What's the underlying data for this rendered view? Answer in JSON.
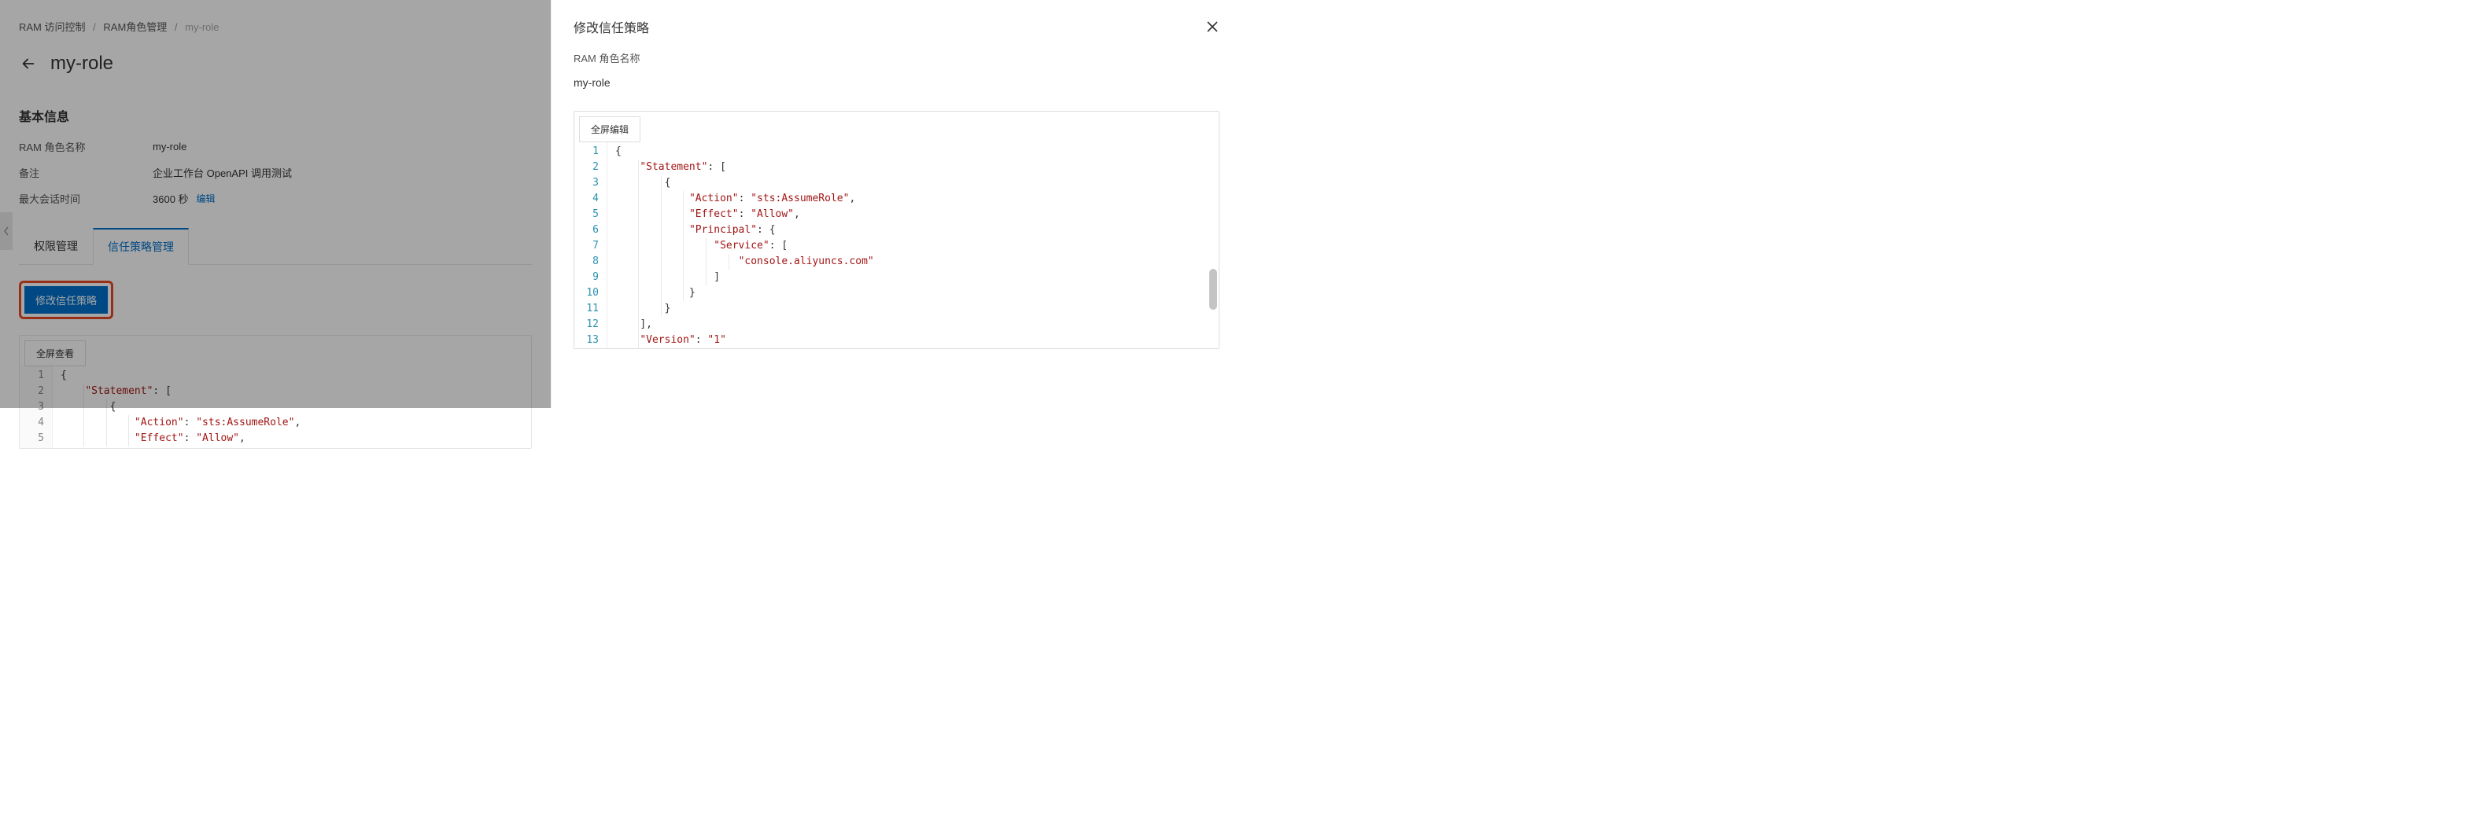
{
  "breadcrumb": {
    "root": "RAM 访问控制",
    "mid": "RAM角色管理",
    "current": "my-role"
  },
  "page_title": "my-role",
  "section_basic": "基本信息",
  "info": {
    "name_label": "RAM 角色名称",
    "name_value": "my-role",
    "note_label": "备注",
    "note_value": "企业工作台 OpenAPI 调用测试",
    "max_session_label": "最大会话时间",
    "max_session_value": "3600 秒",
    "edit": "编辑"
  },
  "tabs": {
    "perm": "权限管理",
    "trust": "信任策略管理"
  },
  "buttons": {
    "modify_trust": "修改信任策略",
    "fullscreen_view": "全屏查看",
    "fullscreen_edit": "全屏编辑"
  },
  "viewer_code": [
    "{",
    "    \"Statement\": [",
    "        {",
    "            \"Action\": \"sts:AssumeRole\",",
    "            \"Effect\": \"Allow\","
  ],
  "drawer": {
    "title": "修改信任策略",
    "role_label": "RAM 角色名称",
    "role_value": "my-role"
  },
  "editor_code": [
    "{",
    "    \"Statement\": [",
    "        {",
    "            \"Action\": \"sts:AssumeRole\",",
    "            \"Effect\": \"Allow\",",
    "            \"Principal\": {",
    "                \"Service\": [",
    "                    \"console.aliyuncs.com\"",
    "                ]",
    "            }",
    "        }",
    "    ],",
    "    \"Version\": \"1\""
  ]
}
